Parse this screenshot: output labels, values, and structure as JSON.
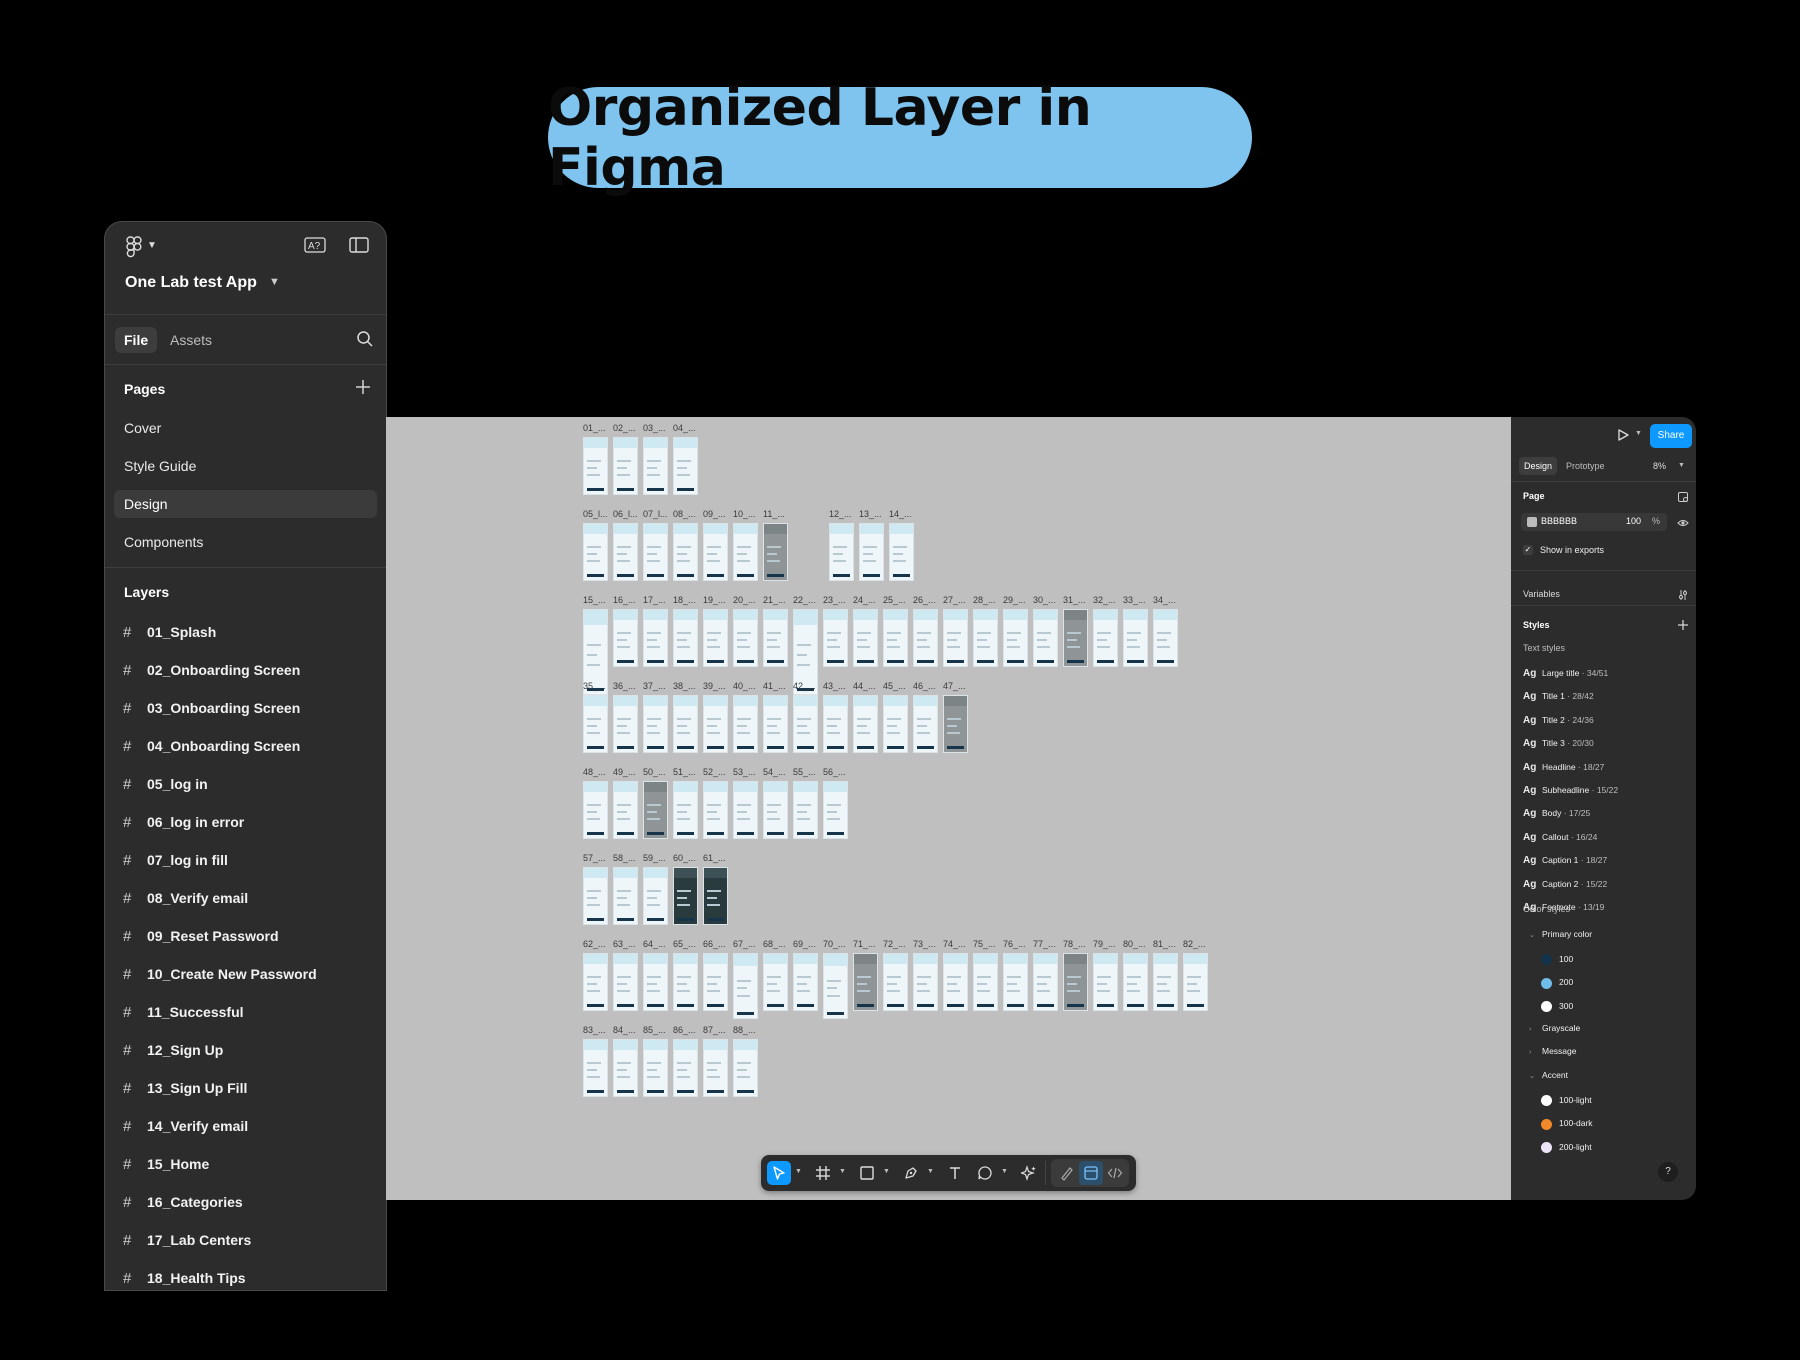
{
  "hero": {
    "title": "Organized Layer in Figma"
  },
  "left_panel": {
    "project_name": "One Lab test App",
    "tabs": {
      "file": "File",
      "assets": "Assets"
    },
    "pages_title": "Pages",
    "pages": [
      "Cover",
      "Style Guide",
      "Design",
      "Components"
    ],
    "selected_page": "Design",
    "layers_title": "Layers",
    "layers": [
      "01_Splash",
      "02_Onboarding Screen",
      "03_Onboarding Screen",
      "04_Onboarding Screen",
      "05_log in",
      "06_log in error",
      "07_log in fill",
      "08_Verify email",
      "09_Reset Password",
      "10_Create New Password",
      "11_Successful",
      "12_Sign Up",
      "13_Sign Up Fill",
      "14_Verify email",
      "15_Home",
      "16_Categories",
      "17_Lab Centers",
      "18_Health Tips"
    ]
  },
  "canvas": {
    "rows": [
      {
        "labels": [
          "01_...",
          "02_...",
          "03_...",
          "04_..."
        ]
      },
      {
        "labels": [
          "05_l...",
          "06_l...",
          "07_l...",
          "08_...",
          "09_...",
          "10_...",
          "11_...",
          "12_...",
          "13_...",
          "14_..."
        ]
      },
      {
        "labels": [
          "15_...",
          "16_...",
          "17_...",
          "18_...",
          "19_...",
          "20_...",
          "21_...",
          "22_...",
          "23_...",
          "24_...",
          "25_...",
          "26_...",
          "27_...",
          "28_...",
          "29_...",
          "30_...",
          "31_...",
          "32_...",
          "33_...",
          "34_..."
        ]
      },
      {
        "labels": [
          "35_...",
          "36_...",
          "37_...",
          "38_...",
          "39_...",
          "40_...",
          "41_...",
          "42_...",
          "43_...",
          "44_...",
          "45_...",
          "46_...",
          "47_..."
        ]
      },
      {
        "labels": [
          "48_...",
          "49_...",
          "50_...",
          "51_...",
          "52_...",
          "53_...",
          "54_...",
          "55_...",
          "56_..."
        ]
      },
      {
        "labels": [
          "57_...",
          "58_...",
          "59_...",
          "60_...",
          "61_..."
        ]
      },
      {
        "labels": [
          "62_...",
          "63_...",
          "64_...",
          "65_...",
          "66_...",
          "67_...",
          "68_...",
          "69_...",
          "70_...",
          "71_...",
          "72_...",
          "73_...",
          "74_...",
          "75_...",
          "76_...",
          "77_...",
          "78_...",
          "79_...",
          "80_...",
          "81_...",
          "82_..."
        ]
      },
      {
        "labels": [
          "83_...",
          "84_...",
          "85_...",
          "86_...",
          "87_...",
          "88_..."
        ]
      }
    ]
  },
  "toolbar": {
    "tools": [
      "move-tool",
      "frame-tool",
      "shape-tool",
      "pen-tool",
      "text-tool",
      "comment-tool",
      "actions-tool",
      "draw-mode",
      "design-mode",
      "dev-mode"
    ]
  },
  "right_panel": {
    "share_label": "Share",
    "tabs": {
      "design": "Design",
      "prototype": "Prototype"
    },
    "zoom": "8%",
    "page_title": "Page",
    "page_color": "BBBBBB",
    "page_opacity": "100",
    "page_opacity_unit": "%",
    "show_in_exports": "Show in exports",
    "variables_title": "Variables",
    "styles_title": "Styles",
    "text_styles_title": "Text styles",
    "text_styles": [
      {
        "ag": "Ag",
        "name": "Large title",
        "meta": " · 34/51"
      },
      {
        "ag": "Ag",
        "name": "Title 1",
        "meta": " · 28/42"
      },
      {
        "ag": "Ag",
        "name": "Title 2",
        "meta": " · 24/36"
      },
      {
        "ag": "Ag",
        "name": "Title 3",
        "meta": " · 20/30"
      },
      {
        "ag": "Ag",
        "name": "Headline",
        "meta": " · 18/27"
      },
      {
        "ag": "Ag",
        "name": "Subheadline",
        "meta": " · 15/22"
      },
      {
        "ag": "Ag",
        "name": "Body",
        "meta": " · 17/25"
      },
      {
        "ag": "Ag",
        "name": "Callout",
        "meta": " · 16/24"
      },
      {
        "ag": "Ag",
        "name": "Caption 1",
        "meta": " · 18/27"
      },
      {
        "ag": "Ag",
        "name": "Caption 2",
        "meta": " · 15/22"
      },
      {
        "ag": "Ag",
        "name": "Footnote",
        "meta": " · 13/19"
      }
    ],
    "color_styles_title": "Color styles",
    "color_groups": {
      "primary": "Primary color",
      "grayscale": "Grayscale",
      "message": "Message",
      "accent": "Accent"
    },
    "primary_colors": [
      {
        "name": "100",
        "color": "#123349"
      },
      {
        "name": "200",
        "color": "#6fbde8"
      },
      {
        "name": "300",
        "color": "#ffffff"
      }
    ],
    "accent_colors": [
      {
        "name": "100-light",
        "color": "#ffffff"
      },
      {
        "name": "100-dark",
        "color": "#f2892a"
      },
      {
        "name": "200-light",
        "color": "#ece4f7"
      }
    ],
    "help": "?"
  }
}
